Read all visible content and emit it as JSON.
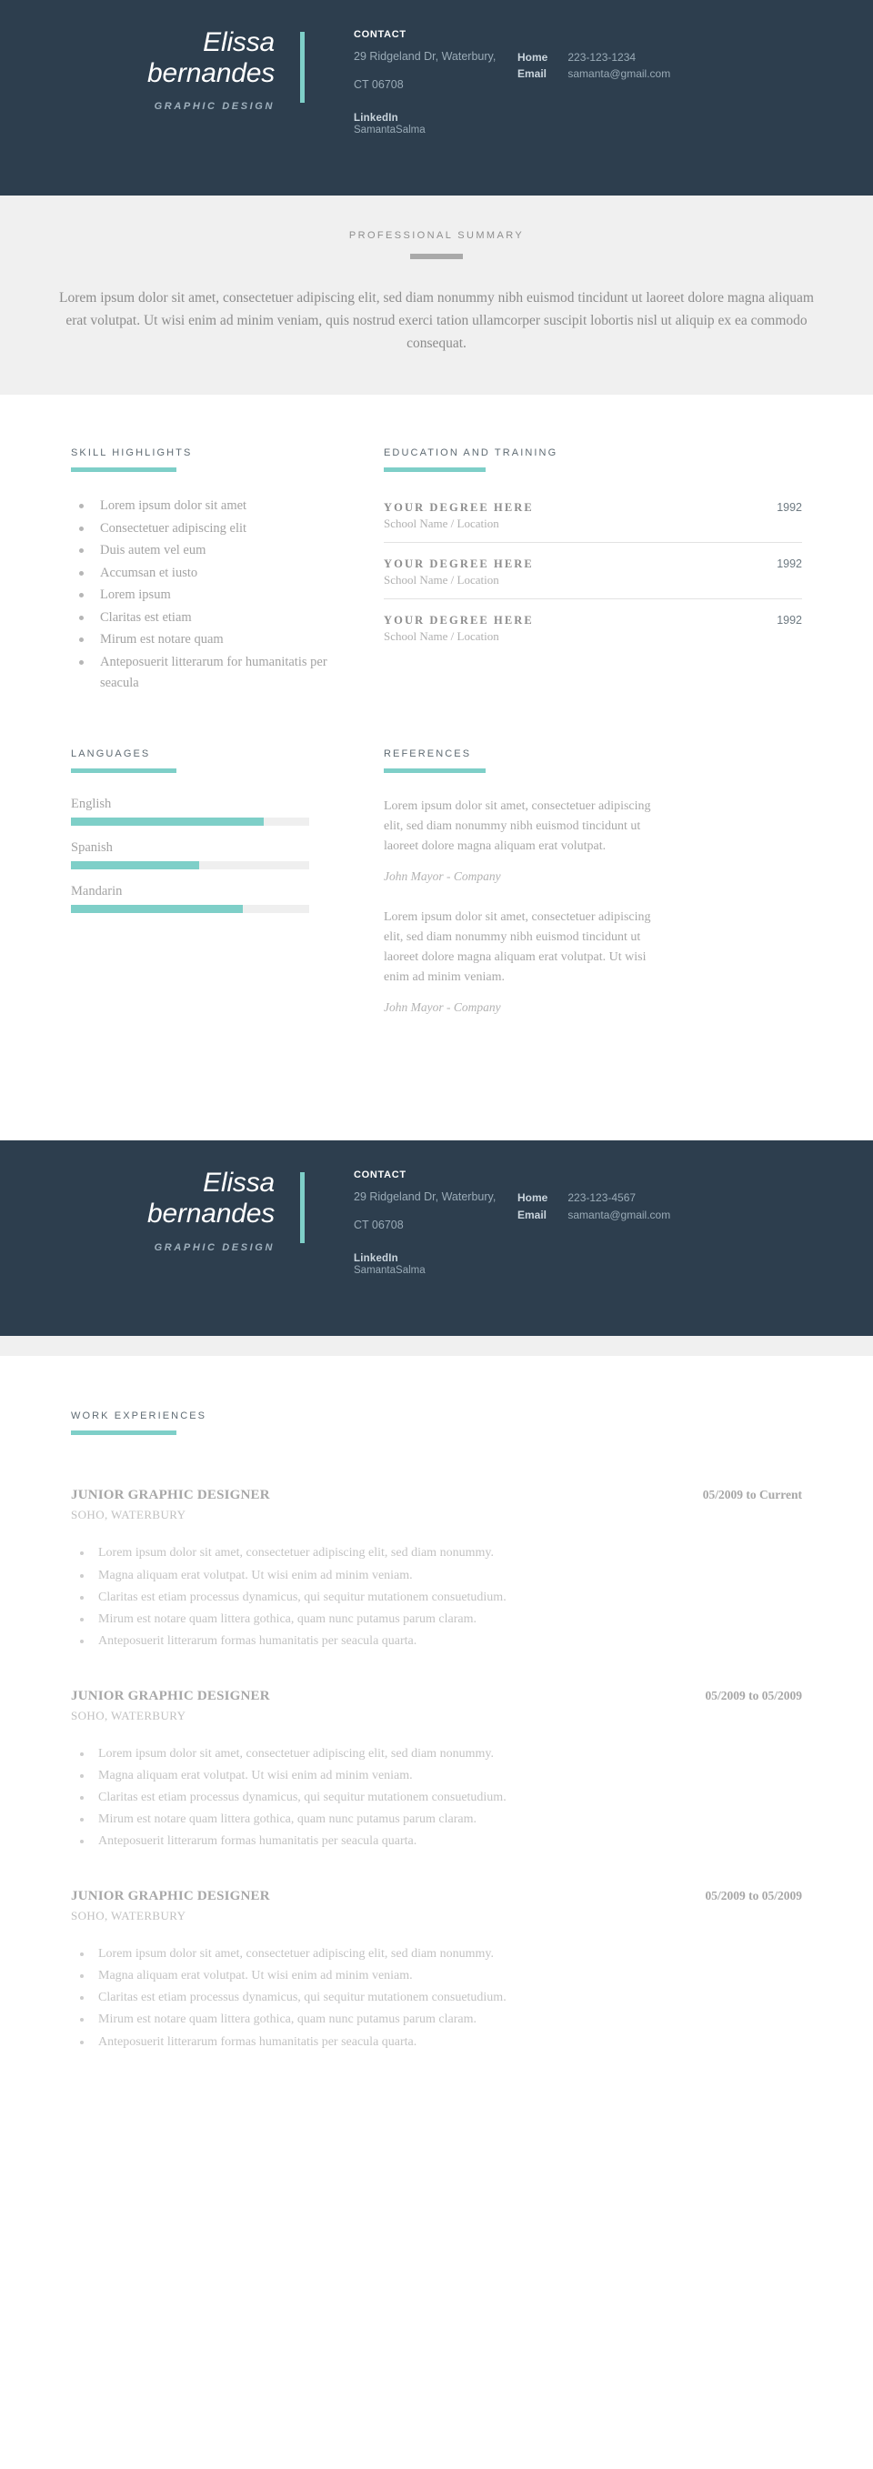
{
  "identity": {
    "first_name": "Elissa",
    "last_name": "bernandes",
    "role": "GRAPHIC DESIGN"
  },
  "colors": {
    "header_bg": "#2d3e4e",
    "accent": "#7ecfc8",
    "band_bg": "#f0f0f0",
    "muted_text": "#a3a3a3"
  },
  "header_page1": {
    "contact_title": "CONTACT",
    "address_line1": "29 Ridgeland Dr, Waterbury,",
    "address_line2": "CT 06708",
    "linkedin_label": "LinkedIn",
    "linkedin_value": "SamantaSalma",
    "meta": [
      {
        "key": "Home",
        "value": "223-123-1234"
      },
      {
        "key": "Email",
        "value": "samanta@gmail.com"
      }
    ]
  },
  "header_page2": {
    "contact_title": "CONTACT",
    "address_line1": "29 Ridgeland Dr, Waterbury,",
    "address_line2": "CT 06708",
    "linkedin_label": "LinkedIn",
    "linkedin_value": "SamantaSalma",
    "meta": [
      {
        "key": "Home",
        "value": "223-123-4567"
      },
      {
        "key": "Email",
        "value": "samanta@gmail.com"
      }
    ]
  },
  "summary": {
    "title": "PROFESSIONAL SUMMARY",
    "text": "Lorem ipsum dolor sit amet, consectetuer adipiscing elit, sed diam nonummy nibh euismod tincidunt ut laoreet dolore magna aliquam erat volutpat. Ut wisi enim ad minim veniam, quis nostrud exerci tation ullamcorper suscipit lobortis nisl ut aliquip ex ea commodo consequat."
  },
  "skills": {
    "title": "SKILL HIGHLIGHTS",
    "items": [
      "Lorem ipsum dolor sit amet",
      "Consectetuer adipiscing elit",
      "Duis autem vel eum",
      "Accumsan et iusto",
      "Lorem ipsum",
      "Claritas est etiam",
      "Mirum est notare quam",
      "Anteposuerit litterarum for humanitatis per seacula"
    ]
  },
  "education": {
    "title": "EDUCATION AND TRAINING",
    "items": [
      {
        "degree": "YOUR DEGREE HERE",
        "school": "School Name / Location",
        "year": "1992"
      },
      {
        "degree": "YOUR DEGREE HERE",
        "school": "School Name / Location",
        "year": "1992"
      },
      {
        "degree": "YOUR DEGREE HERE",
        "school": "School Name / Location",
        "year": "1992"
      }
    ]
  },
  "languages": {
    "title": "LANGUAGES",
    "items": [
      {
        "name": "English",
        "level": 81
      },
      {
        "name": "Spanish",
        "level": 54
      },
      {
        "name": "Mandarin",
        "level": 72
      }
    ]
  },
  "references": {
    "title": "REFERENCES",
    "items": [
      {
        "text": "Lorem ipsum dolor sit amet, consectetuer adipiscing elit, sed diam nonummy nibh euismod tincidunt ut laoreet dolore magna aliquam erat volutpat.",
        "author": "John Mayor - Company"
      },
      {
        "text": "Lorem ipsum dolor sit amet, consectetuer adipiscing elit, sed diam nonummy nibh euismod tincidunt ut laoreet dolore magna aliquam erat volutpat. Ut wisi enim ad minim veniam.",
        "author": "John Mayor - Company"
      }
    ]
  },
  "work": {
    "title": "WORK EXPERIENCES",
    "jobs": [
      {
        "title": "JUNIOR GRAPHIC DESIGNER",
        "dates": "05/2009 to Current",
        "place": "SOHO, WATERBURY",
        "bullets": [
          "Lorem ipsum dolor sit amet, consectetuer adipiscing elit, sed diam nonummy.",
          "Magna aliquam erat volutpat. Ut wisi enim ad minim veniam.",
          "Claritas est etiam processus dynamicus, qui sequitur mutationem consuetudium.",
          "Mirum est notare quam littera gothica, quam nunc putamus parum claram.",
          "Anteposuerit litterarum formas humanitatis per seacula quarta."
        ]
      },
      {
        "title": "JUNIOR GRAPHIC DESIGNER",
        "dates": "05/2009 to 05/2009",
        "place": "SOHO, WATERBURY",
        "bullets": [
          "Lorem ipsum dolor sit amet, consectetuer adipiscing elit, sed diam nonummy.",
          "Magna aliquam erat volutpat. Ut wisi enim ad minim veniam.",
          "Claritas est etiam processus dynamicus, qui sequitur mutationem consuetudium.",
          "Mirum est notare quam littera gothica, quam nunc putamus parum claram.",
          "Anteposuerit litterarum formas humanitatis per seacula quarta."
        ]
      },
      {
        "title": "JUNIOR GRAPHIC DESIGNER",
        "dates": "05/2009 to 05/2009",
        "place": "SOHO, WATERBURY",
        "bullets": [
          "Lorem ipsum dolor sit amet, consectetuer adipiscing elit, sed diam nonummy.",
          "Magna aliquam erat volutpat. Ut wisi enim ad minim veniam.",
          "Claritas est etiam processus dynamicus, qui sequitur mutationem consuetudium.",
          "Mirum est notare quam littera gothica, quam nunc putamus parum claram.",
          "Anteposuerit litterarum formas humanitatis per seacula quarta."
        ]
      }
    ]
  }
}
